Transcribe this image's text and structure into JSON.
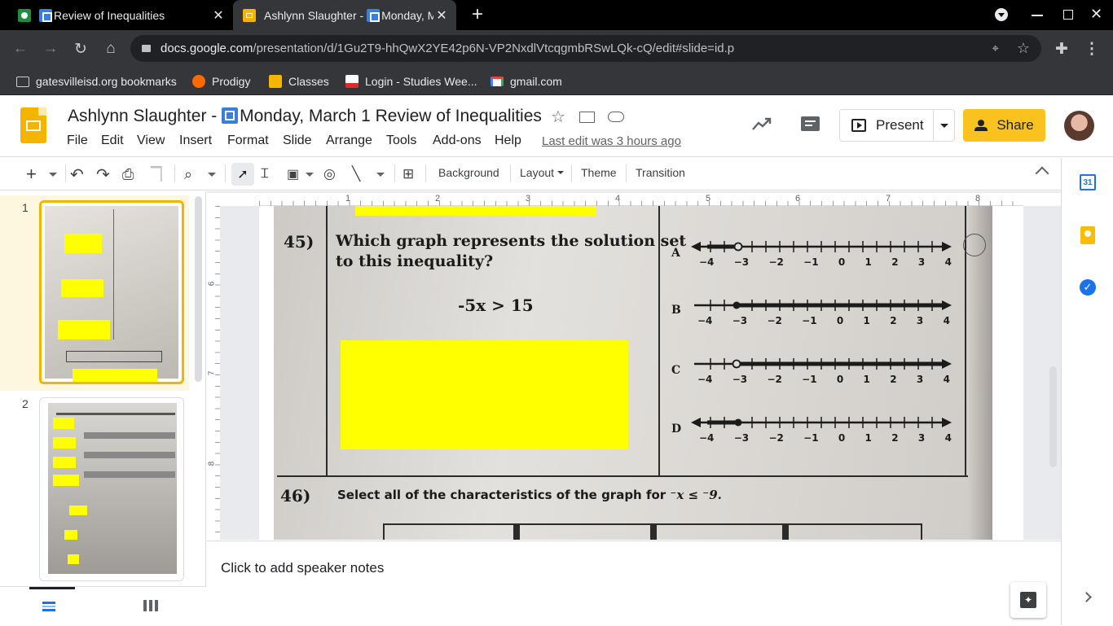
{
  "browser": {
    "tabs": [
      {
        "title": "Review of Inequalities",
        "active": false
      },
      {
        "title": "Ashlynn Slaughter - ",
        "title_suffix": "Monday, M",
        "active": true
      }
    ],
    "url_host": "docs.google.com",
    "url_path": "/presentation/d/1Gu2T9-hhQwX2YE42p6N-VP2NxdlVtcqgmbRSwLQk-cQ/edit#slide=id.p",
    "bookmarks": [
      {
        "label": "gatesvilleisd.org bookmarks",
        "icon": "folder-icon"
      },
      {
        "label": "Prodigy",
        "icon": "prodigy-icon"
      },
      {
        "label": "Classes",
        "icon": "classroom-icon"
      },
      {
        "label": "Login - Studies Wee...",
        "icon": "studies-weekly-icon"
      },
      {
        "label": "gmail.com",
        "icon": "gmail-icon"
      }
    ]
  },
  "doc": {
    "title_prefix": "Ashlynn Slaughter - ",
    "title_rest": "Monday, March 1 Review of Inequalities",
    "menus": [
      "File",
      "Edit",
      "View",
      "Insert",
      "Format",
      "Slide",
      "Arrange",
      "Tools",
      "Add-ons",
      "Help"
    ],
    "last_edit": "Last edit was 3 hours ago",
    "present_label": "Present",
    "share_label": "Share"
  },
  "toolbar": {
    "background_label": "Background",
    "layout_label": "Layout",
    "theme_label": "Theme",
    "transition_label": "Transition"
  },
  "ruler": {
    "h_labels": [
      "1",
      "2",
      "3",
      "4",
      "5",
      "6",
      "7",
      "8"
    ],
    "v_labels": [
      "6",
      "7",
      "8"
    ]
  },
  "filmstrip": {
    "slides": [
      {
        "number": "1",
        "selected": true
      },
      {
        "number": "2",
        "selected": false
      }
    ]
  },
  "slide": {
    "q45_number": "45)",
    "q45_line1": "Which graph represents the solution set",
    "q45_line2": "to this inequality?",
    "q45_inequality": "-5x > 15",
    "options": [
      "A",
      "B",
      "C",
      "D"
    ],
    "tick_labels": [
      "−4",
      "−3",
      "−2",
      "−1",
      "0",
      "1",
      "2",
      "3",
      "4"
    ],
    "q46_number": "46)",
    "q46_text": "Select all of the characteristics of the graph for ",
    "q46_expr": "⁻x ≤ ⁻9."
  },
  "notes": {
    "placeholder": "Click to add speaker notes"
  },
  "colors": {
    "highlight": "#ffff00",
    "share": "#f9c21e",
    "slides_yellow": "#f4b400"
  }
}
